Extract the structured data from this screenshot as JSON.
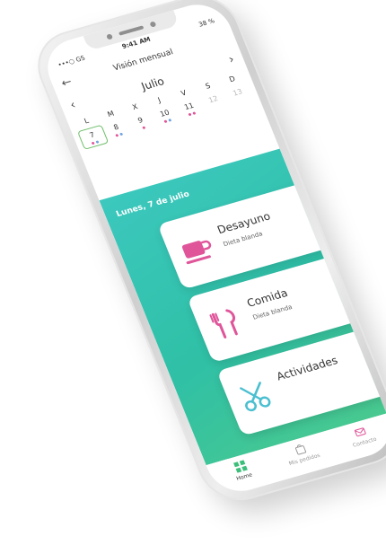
{
  "status": {
    "carrier": "•••○ GS",
    "time": "9:41 AM",
    "battery": "38 %"
  },
  "nav": {
    "title": "Visión mensual",
    "back_icon": "arrow-left-icon",
    "next_icon": "chevron-right-icon"
  },
  "calendar": {
    "month": "Julio",
    "weekdays": [
      "L",
      "M",
      "X",
      "J",
      "V",
      "S",
      "D"
    ],
    "days": [
      {
        "num": "7",
        "selected": true,
        "dots": [
          "#e0559a",
          "#6fa3df"
        ]
      },
      {
        "num": "8",
        "dots": [
          "#e0559a",
          "#6fa3df"
        ]
      },
      {
        "num": "9",
        "dots": [
          "#e0559a"
        ]
      },
      {
        "num": "10",
        "dots": [
          "#e0559a",
          "#6fa3df"
        ]
      },
      {
        "num": "11",
        "dots": [
          "#e0559a",
          "#e0559a"
        ]
      },
      {
        "num": "12",
        "muted": true,
        "dots": []
      },
      {
        "num": "13",
        "muted": true,
        "dots": []
      }
    ]
  },
  "day_label": "Lunes, 7 de julio",
  "cards": [
    {
      "name": "Desayuno",
      "sub": "Dieta blanda",
      "icon": "coffee-cup-icon"
    },
    {
      "name": "Comida",
      "sub": "Dieta blanda",
      "icon": "fork-knife-icon"
    },
    {
      "name": "Actividades",
      "sub": "",
      "icon": "scissors-icon"
    }
  ],
  "tabs": [
    {
      "label": "Home",
      "icon": "home-grid-icon",
      "active": true
    },
    {
      "label": "Mis pedidos",
      "icon": "bag-icon",
      "active": false
    },
    {
      "label": "Contacto",
      "icon": "mail-icon",
      "active": false
    }
  ],
  "colors": {
    "teal": "#34c4b2",
    "pink": "#e0559a",
    "accent_green": "#6fbf6a"
  }
}
